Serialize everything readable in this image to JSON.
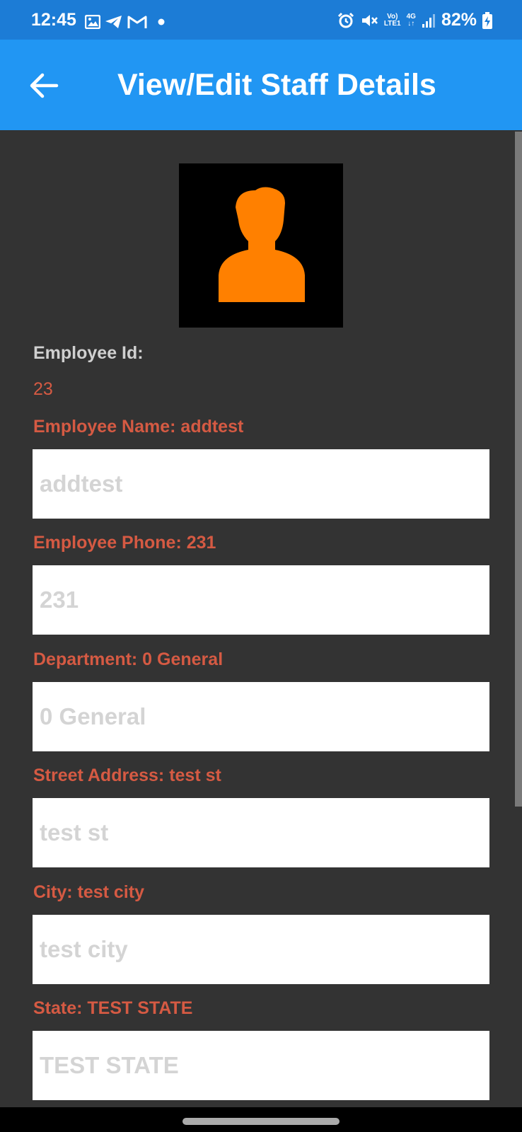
{
  "status_bar": {
    "time": "12:45",
    "volte": "Vo)",
    "lte": "LTE1",
    "network": "4G",
    "battery": "82%"
  },
  "app_bar": {
    "title": "View/Edit Staff Details"
  },
  "employee": {
    "id_label": "Employee Id:",
    "id_value": "23"
  },
  "fields": [
    {
      "label": "Employee Name: addtest",
      "placeholder": "addtest"
    },
    {
      "label": "Employee Phone: 231",
      "placeholder": "231"
    },
    {
      "label": "Department: 0 General",
      "placeholder": "0 General"
    },
    {
      "label": "Street Address: test st",
      "placeholder": "test st"
    },
    {
      "label": "City: test city",
      "placeholder": "test city"
    },
    {
      "label": "State: TEST STATE",
      "placeholder": "TEST STATE"
    }
  ],
  "colors": {
    "status_bar": "#1c7cd6",
    "app_bar": "#2196f3",
    "background": "#333333",
    "label": "#d55a43",
    "avatar_figure": "#ff8000"
  },
  "icons": [
    "image-icon",
    "telegram-icon",
    "gmail-icon",
    "alarm-icon",
    "mute-icon",
    "signal-icon",
    "battery-charging-icon",
    "back-arrow-icon",
    "person-icon"
  ]
}
